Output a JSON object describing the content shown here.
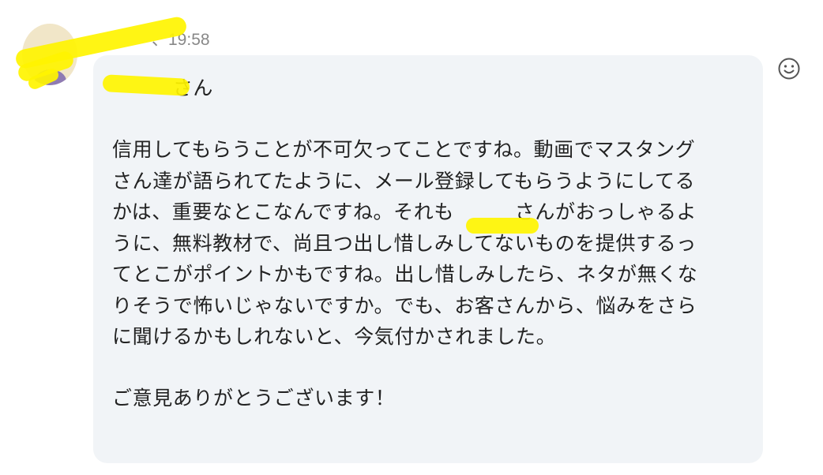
{
  "message": {
    "sender": "",
    "time": "、19:58",
    "greeting": "　　　さん",
    "paragraph": "信用してもらうことが不可欠ってことですね。動画でマスタング\nさん達が語られてたように、メール登録してもらうようにしてる\nかは、重要なとこなんですね。それも　　　さんがおっしゃるよ\nうに、無料教材で、尚且つ出し惜しみしてないものを提供するっ\nてとこがポイントかもですね。出し惜しみしたら、ネタが無くな\nりそうで怖いじゃないですか。でも、お客さんから、悩みをさら\nに聞けるかもしれないと、今気付かされました。",
    "thanks": "ご意見ありがとうございます！"
  },
  "icons": {
    "emoji": "smile-icon"
  }
}
